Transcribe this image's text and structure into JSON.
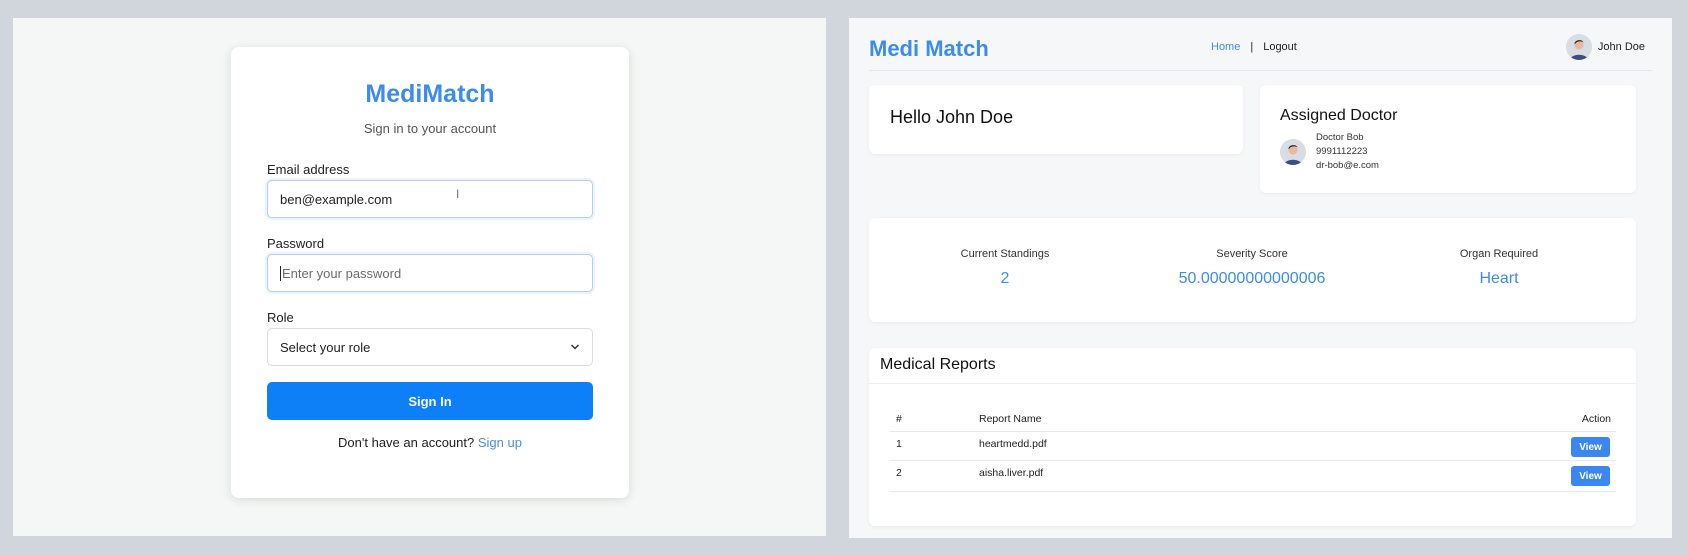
{
  "login": {
    "brand": "MediMatch",
    "subtitle": "Sign in to your account",
    "email_label": "Email address",
    "email_value": "ben@example.com",
    "password_label": "Password",
    "password_placeholder": "Enter your password",
    "role_label": "Role",
    "role_selected": "Select your role",
    "signin_label": "Sign In",
    "signup_prompt": "Don't have an account?",
    "signup_link": "Sign up"
  },
  "dashboard": {
    "logo": "Medi Match",
    "nav": {
      "home": "Home",
      "separator": "|",
      "logout": "Logout"
    },
    "user_name": "John Doe",
    "greeting": "Hello John Doe",
    "assigned_doctor": {
      "title": "Assigned Doctor",
      "name": "Doctor Bob",
      "phone": "9991112223",
      "email": "dr-bob@e.com"
    },
    "stats": [
      {
        "label": "Current Standings",
        "value": "2"
      },
      {
        "label": "Severity Score",
        "value": "50.00000000000006"
      },
      {
        "label": "Organ Required",
        "value": "Heart"
      }
    ],
    "reports": {
      "title": "Medical Reports",
      "headers": {
        "num": "#",
        "name": "Report Name",
        "action": "Action"
      },
      "rows": [
        {
          "num": "1",
          "name": "heartmedd.pdf",
          "action": "View"
        },
        {
          "num": "2",
          "name": "aisha.liver.pdf",
          "action": "View"
        }
      ]
    }
  },
  "colors": {
    "accent": "#3b8ceb",
    "primary_button": "#0d7ff7"
  }
}
